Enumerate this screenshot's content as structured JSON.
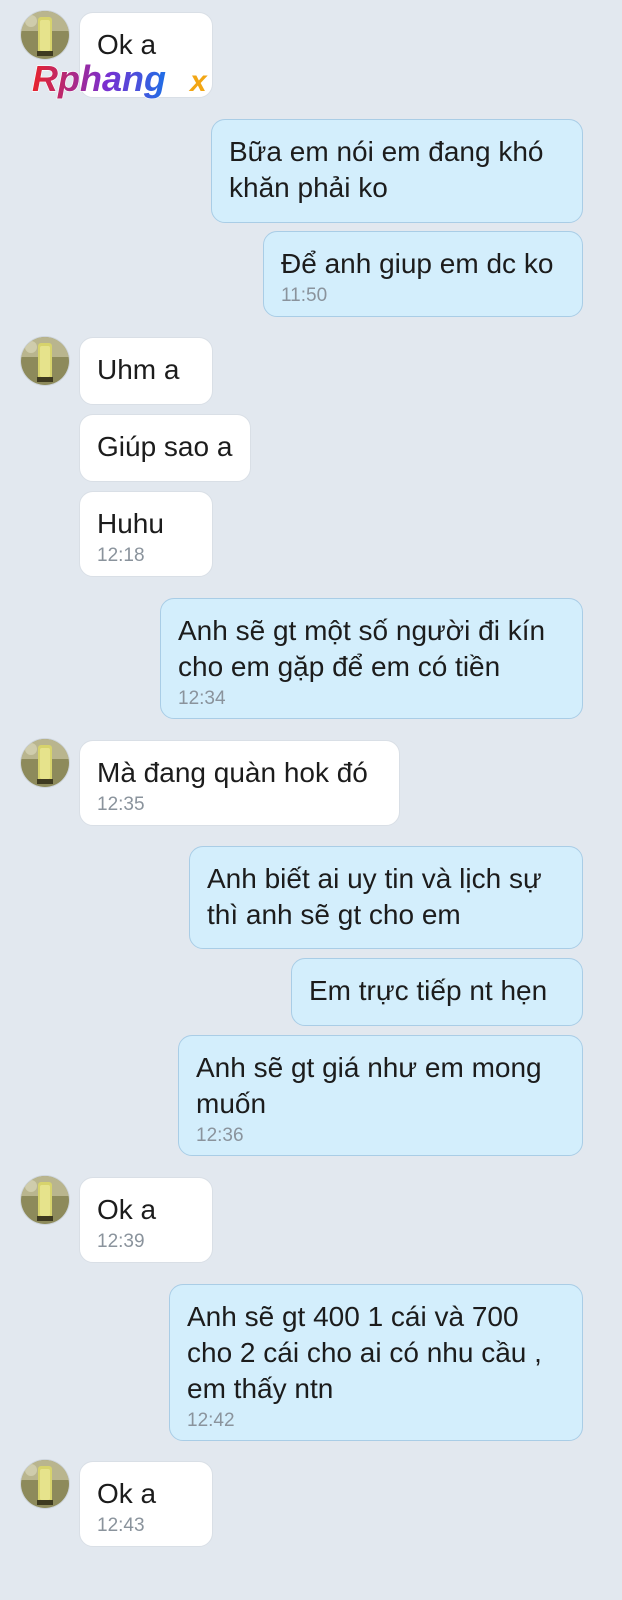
{
  "conversation": {
    "messages": [
      {
        "side": "in",
        "text": "Ok a",
        "time": ""
      },
      {
        "side": "out",
        "text": "Bữa em nói em đang khó khăn phải ko",
        "time": ""
      },
      {
        "side": "out",
        "text": "Để anh giup em dc ko",
        "time": "11:50"
      },
      {
        "side": "in",
        "text": "Uhm a",
        "time": ""
      },
      {
        "side": "in",
        "text": "Giúp sao a",
        "time": ""
      },
      {
        "side": "in",
        "text": "Huhu",
        "time": "12:18"
      },
      {
        "side": "out",
        "text": "Anh sẽ gt một số người đi kín cho em gặp để em có tiền",
        "time": "12:34"
      },
      {
        "side": "in",
        "text": "Mà đang quàn hok đó",
        "time": "12:35"
      },
      {
        "side": "out",
        "text": "Anh biết ai uy tin và lịch sự thì anh sẽ gt cho em",
        "time": ""
      },
      {
        "side": "out",
        "text": "Em trực tiếp nt hẹn",
        "time": ""
      },
      {
        "side": "out",
        "text": "Anh sẽ gt giá như em mong muốn",
        "time": "12:36"
      },
      {
        "side": "in",
        "text": "Ok a",
        "time": "12:39"
      },
      {
        "side": "out",
        "text": "Anh sẽ gt 400 1 cái và 700 cho 2 cái cho ai có nhu cầu , em thấy ntn",
        "time": "12:42"
      },
      {
        "side": "in",
        "text": "Ok a",
        "time": "12:43"
      }
    ]
  },
  "watermark": {
    "text_main": "Rphang",
    "text_suffix": "x",
    "colors": {
      "gradient_start": "#e8232a",
      "gradient_mid": "#7a2fd0",
      "gradient_end": "#1f6fe6",
      "suffix": "#f2a614"
    }
  },
  "colors": {
    "background": "#e2e8ef",
    "incoming_bubble": "#ffffff",
    "outgoing_bubble": "#d3eefc",
    "text": "#1c1c1c",
    "timestamp": "#8a939c"
  },
  "icons": {
    "avatar": "contact-avatar-icon"
  }
}
